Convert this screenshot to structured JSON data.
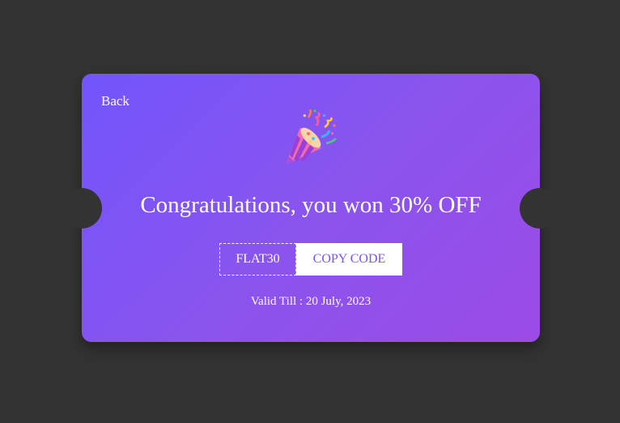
{
  "coupon": {
    "back_label": "Back",
    "icon": "party-popper-icon",
    "headline": "Congratulations, you won 30% OFF",
    "code": "FLAT30",
    "copy_label": "COPY CODE",
    "validity": "Valid Till : 20 July, 2023"
  },
  "colors": {
    "background": "#333333",
    "gradient_start": "#7255fc",
    "gradient_end": "#9c4be6",
    "copy_text": "#7a52f3"
  }
}
